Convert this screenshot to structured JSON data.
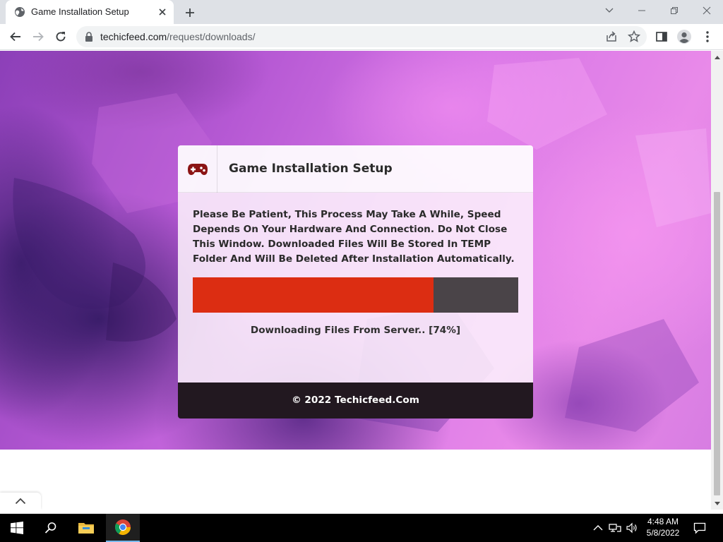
{
  "browser": {
    "tab_title": "Game Installation Setup",
    "url_domain": "techicfeed.com",
    "url_path": "/request/downloads/"
  },
  "page": {
    "card_title": "Game Installation Setup",
    "notice": "Please Be Patient, This Process May Take A While, Speed Depends On Your Hardware And Connection. Do Not Close This Window. Downloaded Files Will Be Stored In TEMP Folder And Will Be Deleted After Installation Automatically.",
    "progress_percent": 74,
    "status": "Downloading Files From Server.. [74%]",
    "footer": "© 2022 Techicfeed.Com",
    "colors": {
      "progress_fill": "#dc2d12",
      "progress_track": "#4a4448",
      "footer_bg": "#221820",
      "gamepad_icon": "#8b1414"
    }
  },
  "taskbar": {
    "time": "4:48 AM",
    "date": "5/8/2022",
    "apps": [
      "start",
      "search",
      "file-explorer",
      "chrome"
    ]
  }
}
